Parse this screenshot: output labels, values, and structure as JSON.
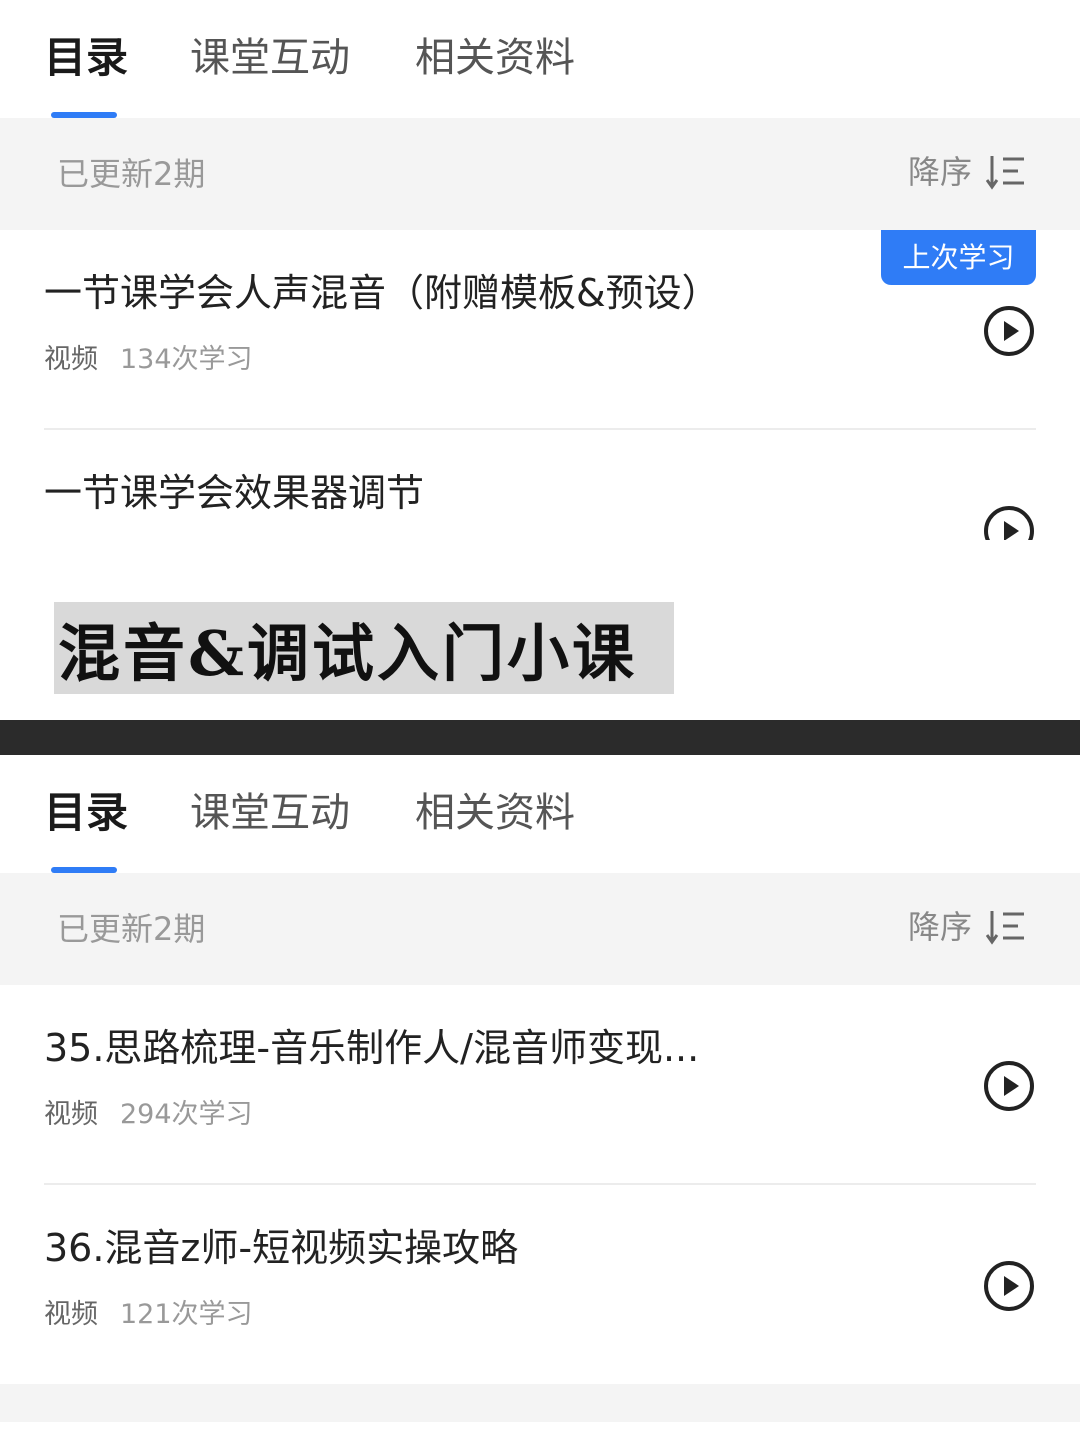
{
  "tabs": [
    {
      "label": "目录"
    },
    {
      "label": "课堂互动"
    },
    {
      "label": "相关资料"
    }
  ],
  "colors": {
    "accent": "#2f7cf6",
    "banner_bg": "#d9d9d9",
    "separator": "#2b2b2b"
  },
  "panel1": {
    "updated": "已更新2期",
    "sort_label": "降序",
    "items": [
      {
        "title": "一节课学会人声混音（附赠模板&预设）",
        "type": "视频",
        "views": "134次学习",
        "badge": "上次学习"
      },
      {
        "title": "一节课学会效果器调节"
      }
    ]
  },
  "banner": {
    "text": "混音&调试入门小课"
  },
  "panel2": {
    "updated": "已更新2期",
    "sort_label": "降序",
    "items": [
      {
        "title": "35.思路梳理-音乐制作人/混音师变现...",
        "type": "视频",
        "views": "294次学习"
      },
      {
        "title": "36.混音z师-短视频实操攻略",
        "type": "视频",
        "views": "121次学习"
      }
    ]
  },
  "icons": {
    "play": "play-circle-icon",
    "sort": "sort-descending-icon"
  }
}
